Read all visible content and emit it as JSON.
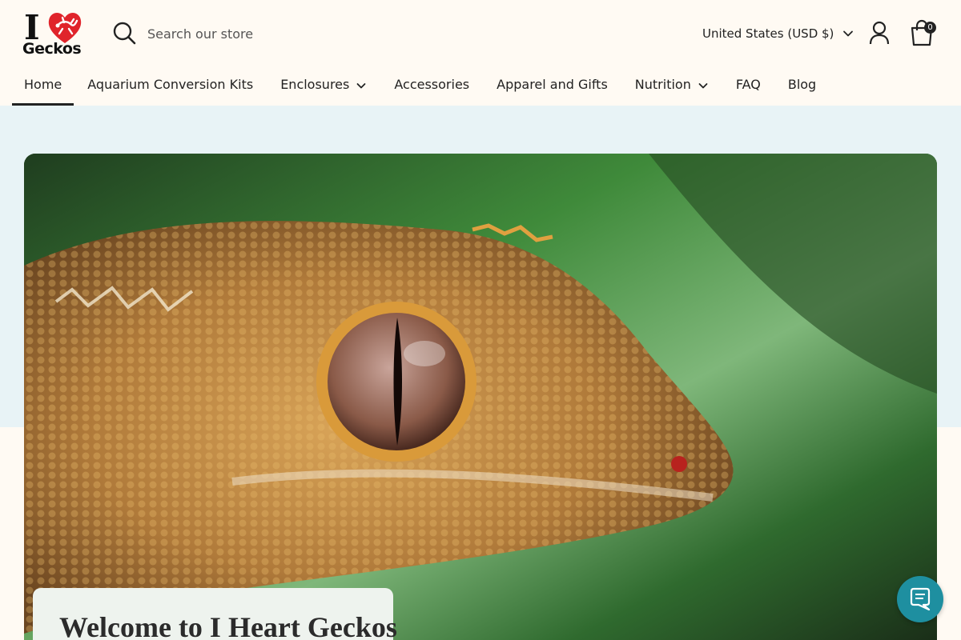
{
  "brand": {
    "logo_top": "I",
    "logo_bottom": "Geckos",
    "heart_color": "#e0242b"
  },
  "search": {
    "placeholder": "Search our store"
  },
  "header": {
    "currency_label": "United States (USD $)",
    "cart_count": "0"
  },
  "nav": {
    "items": [
      {
        "label": "Home",
        "active": true
      },
      {
        "label": "Aquarium Conversion Kits"
      },
      {
        "label": "Enclosures",
        "dropdown": true
      },
      {
        "label": "Accessories"
      },
      {
        "label": "Apparel and Gifts"
      },
      {
        "label": "Nutrition",
        "dropdown": true
      },
      {
        "label": "FAQ"
      },
      {
        "label": "Blog"
      }
    ]
  },
  "hero": {
    "welcome_title": "Welcome to I Heart Geckos"
  },
  "colors": {
    "page_bg": "#fffaf3",
    "band_bg": "#e8f3f6",
    "chat_bg": "#1e8fa0"
  }
}
